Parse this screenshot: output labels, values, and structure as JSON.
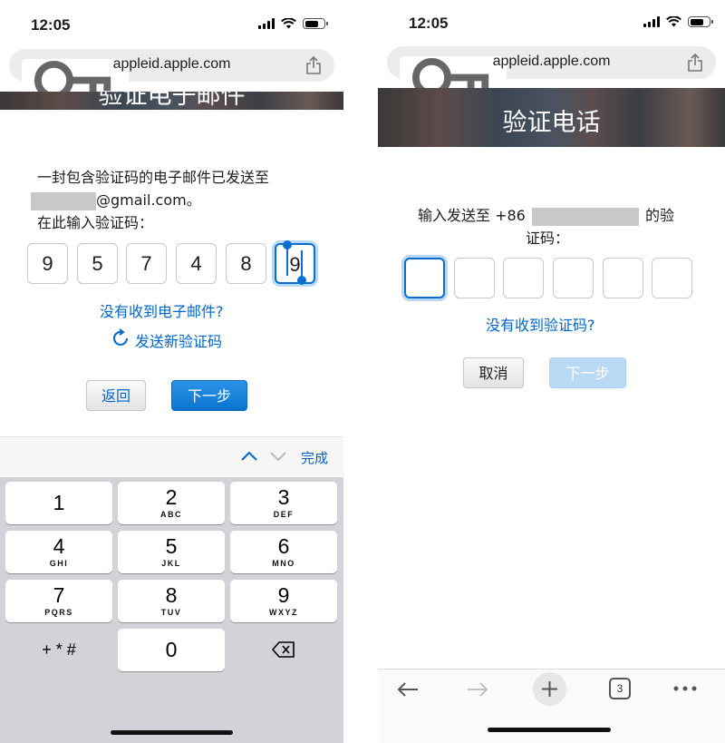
{
  "left": {
    "status": {
      "time": "12:05"
    },
    "url": "appleid.apple.com",
    "hero_partial_title": "验证电子邮件",
    "message": {
      "line1": "一封包含验证码的电子邮件已发送至",
      "email_suffix": "@gmail.com。",
      "line3": "在此输入验证码："
    },
    "code": [
      "9",
      "5",
      "7",
      "4",
      "8",
      "9"
    ],
    "no_email_link": "没有收到电子邮件?",
    "resend_link": "发送新验证码",
    "back_button": "返回",
    "next_button": "下一步",
    "toolbar_done": "完成",
    "keypad": [
      {
        "num": "1",
        "sub": ""
      },
      {
        "num": "2",
        "sub": "ABC"
      },
      {
        "num": "3",
        "sub": "DEF"
      },
      {
        "num": "4",
        "sub": "GHI"
      },
      {
        "num": "5",
        "sub": "JKL"
      },
      {
        "num": "6",
        "sub": "MNO"
      },
      {
        "num": "7",
        "sub": "PQRS"
      },
      {
        "num": "8",
        "sub": "TUV"
      },
      {
        "num": "9",
        "sub": "WXYZ"
      },
      {
        "num": "0",
        "sub": ""
      }
    ],
    "symbols_key": "+ * #"
  },
  "right": {
    "status": {
      "time": "12:05"
    },
    "url": "appleid.apple.com",
    "hero_title": "验证电话",
    "prompt_prefix": "输入发送至 +86",
    "prompt_suffix": "的验",
    "prompt_line2": "证码：",
    "no_code_link": "没有收到验证码?",
    "cancel_button": "取消",
    "next_button": "下一步",
    "tab_count": "3"
  },
  "colors": {
    "link": "#0066cc",
    "primary_button": "#0b74cf",
    "disabled_button": "#b9d9f5",
    "keyboard_bg": "#d1d3d9"
  },
  "icons": [
    "key-icon",
    "share-icon",
    "refresh-icon",
    "chevron-up-icon",
    "chevron-down-icon",
    "delete-icon",
    "back-arrow-icon",
    "forward-arrow-icon",
    "plus-icon",
    "tabs-icon",
    "more-icon"
  ]
}
